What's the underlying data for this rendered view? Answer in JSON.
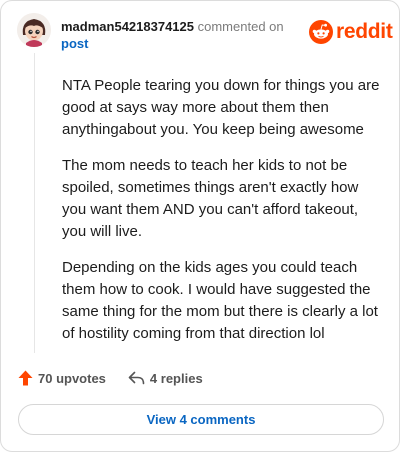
{
  "header": {
    "username": "madman54218374125",
    "action_text": "commented on",
    "post_link": "post"
  },
  "brand": {
    "wordmark": "reddit",
    "color": "#ff4500"
  },
  "comment": {
    "paragraphs": [
      "NTA People tearing you down for things you are good at says way more about them then anythingabout you. You keep being awesome",
      "The mom needs to teach her kids to not be spoiled, sometimes things aren't exactly how you want them AND you can't afford takeout, you will live.",
      "Depending on the kids ages you could teach them how to cook. I would have suggested the same thing for the mom but there is clearly a lot of hostility coming from that direction lol"
    ]
  },
  "actions": {
    "upvotes_label": "70 upvotes",
    "replies_label": "4 replies",
    "upvote_icon": "upvote-arrow-icon",
    "reply_icon": "reply-arrow-icon"
  },
  "footer": {
    "view_comments_label": "View 4 comments",
    "link_color": "#0a66c2"
  }
}
